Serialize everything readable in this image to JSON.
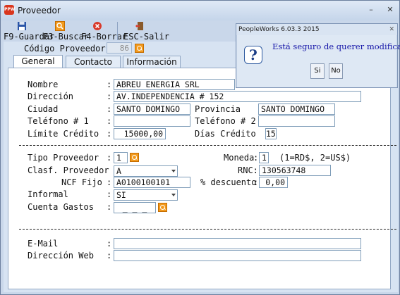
{
  "window": {
    "title": "Proveedor",
    "app_icon_text": "PPW"
  },
  "toolbar": {
    "guardar": "F9-Guardar",
    "buscar": "F3-Buscar",
    "borrar": "F4-Borrar",
    "salir": "ESC-Salir"
  },
  "header": {
    "codigo_label": "Código Proveedor:",
    "codigo_value": "86"
  },
  "tabs": [
    {
      "label": "General"
    },
    {
      "label": "Contacto"
    },
    {
      "label": "Información"
    }
  ],
  "form": {
    "nombre_label": "Nombre",
    "nombre_value": "ABREU ENERGIA SRL",
    "direccion_label": "Dirección",
    "direccion_value": "AV.INDEPENDENCIA # 152",
    "ciudad_label": "Ciudad",
    "ciudad_value": "SANTO DOMINGO",
    "provincia_label": "Provincia",
    "provincia_value": "SANTO DOMINGO",
    "telefono1_label": "Teléfono # 1",
    "telefono1_value": "",
    "telefono2_label": "Teléfono # 2",
    "telefono2_value": "",
    "limite_label": "Límite Crédito",
    "limite_value": "15000,00",
    "dias_label": "Días Crédito",
    "dias_value": "15",
    "tipo_label": "Tipo Proveedor",
    "tipo_value": "1",
    "moneda_label": "Moneda",
    "moneda_value": "1",
    "moneda_hint": "(1=RD$, 2=US$)",
    "clasf_label": "Clasf. Proveedor",
    "clasf_value": "A",
    "rnc_label": "RNC:",
    "rnc_value": "130563748",
    "ncf_label": "NCF Fijo",
    "ncf_value": "A0100100101",
    "descuento_label": "% descuento",
    "descuento_value": "0,00",
    "informal_label": "Informal",
    "informal_value": "SI",
    "cuenta_label": "Cuenta Gastos",
    "cuenta_value": "_ _ _",
    "email_label": "E-Mail",
    "email_value": "",
    "web_label": "Dirección Web",
    "web_value": ""
  },
  "dialog": {
    "title": "PeopleWorks 6.03.3 2015",
    "message": "Está seguro de querer modificar.",
    "yes": "Si",
    "no": "No"
  },
  "colors": {
    "accent": "#f29a1e",
    "dialog_text": "#1515a8"
  }
}
